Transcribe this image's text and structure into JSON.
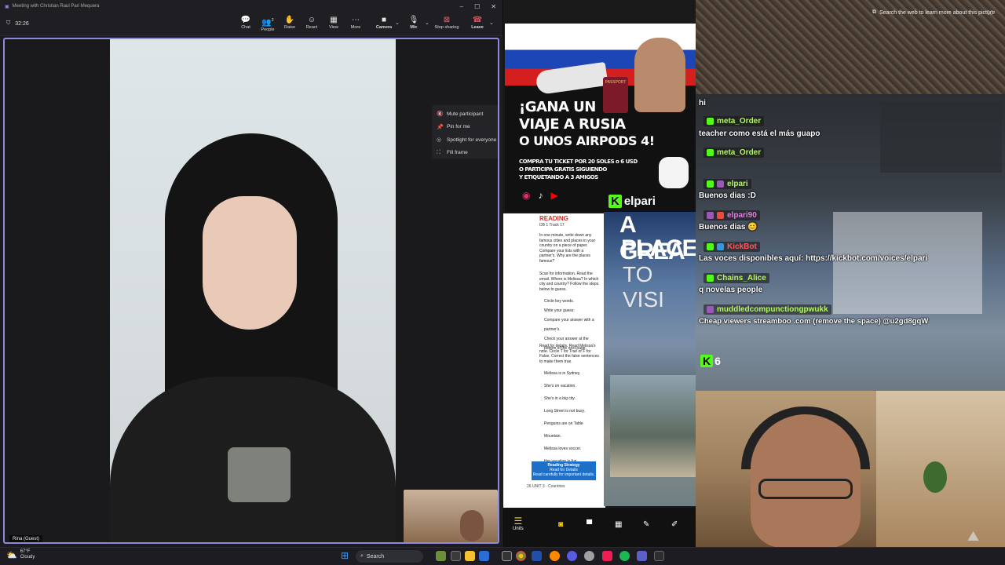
{
  "teams": {
    "window_title": "Meeting with Christian Raul Pari Mequera",
    "timer": "32:26",
    "toolbar": [
      {
        "label": "Chat",
        "icon": "chat-icon"
      },
      {
        "label": "People",
        "icon": "people-icon"
      },
      {
        "label": "Raise",
        "icon": "raise-hand-icon"
      },
      {
        "label": "React",
        "icon": "react-icon"
      },
      {
        "label": "View",
        "icon": "view-icon"
      },
      {
        "label": "More",
        "icon": "more-icon"
      },
      {
        "label": "Camera",
        "icon": "camera-icon"
      },
      {
        "label": "Mic",
        "icon": "mic-icon"
      },
      {
        "label": "Stop sharing",
        "icon": "stop-sharing-icon"
      },
      {
        "label": "Leave",
        "icon": "leave-icon"
      }
    ],
    "people_count": "2",
    "context_menu": [
      {
        "label": "Mute participant",
        "icon": "mute-icon"
      },
      {
        "label": "Pin for me",
        "icon": "pin-icon"
      },
      {
        "label": "Spotlight for everyone",
        "icon": "spotlight-icon"
      },
      {
        "label": "Fill frame",
        "icon": "fill-frame-icon"
      }
    ],
    "guest_name": "Rina (Guest)"
  },
  "right": {
    "search_web": "Search the web to learn more about this picture",
    "promo": {
      "line1": "¡GANA UN",
      "line2": "VIAJE A RUSIA",
      "line3": "O UNOS AIRPODS 4!",
      "line4": "COMPRA TU TICKET POR 20 SOLES o 6 USD",
      "line5": "O PARTICIPA GRATIS SIGUIENDO",
      "line6": "Y ETIQUETANDO A 3 AMIGOS",
      "brand": "elpari",
      "passport": "PASSPORT"
    },
    "book": {
      "section": "READING",
      "track": "DB 1 Track 17",
      "city_title_1": "A GREA",
      "city_title_2": "PLACE",
      "city_title_3": "TO VISI",
      "a_text": "In one minute, write down any famous cities and places in your country on a piece of paper. Compare your lists with a partner's. Why are the places famous?",
      "b_text": "Scan for information. Read the email. Where is Melissa? In which city and country? Follow the steps below to guess.",
      "steps": [
        "Circle key words.",
        "Write your guess:",
        "Compare your answer with a partner's.",
        "Check your answer at the bottom of the next page."
      ],
      "c_text": "Read for details. Read Melissa's note. Circle T for True or F for False. Correct the false sentences to make them true.",
      "tf": [
        "Melissa is in Sydney.",
        "She's on vacation.",
        "She's in a big city.",
        "Long Street is not busy.",
        "Penguins are on Table Mountain.",
        "Melissa loves soccer.",
        "Her vacation is fun."
      ],
      "strategy_title": "Reading Strategy",
      "strategy_sub": "Read for Details",
      "strategy_text": "Read carefully for important details.",
      "footer": "26  UNIT 3 · Countries",
      "units_label": "Units"
    },
    "chat": [
      {
        "user": "",
        "message": "hi",
        "color": "#ffffff"
      },
      {
        "user": "meta_Order",
        "message": "teacher como está el más guapo",
        "color": "#b6f26b"
      },
      {
        "user": "meta_Order",
        "message": "",
        "color": "#b6f26b"
      },
      {
        "user": "elpari",
        "message": "Buenos dias :D",
        "color": "#b6f26b"
      },
      {
        "user": "elpari90",
        "message": "Buenos dias",
        "color": "#e07be0"
      },
      {
        "user": "KickBot",
        "message": "Las voces disponibles aquí: https://kickbot.com/voices/elpari",
        "color": "#ff5a5a"
      },
      {
        "user": "Chains_Alice",
        "message": "q novelas people",
        "color": "#b6f26b"
      },
      {
        "user": "muddledcompunctiongpwukk",
        "message": "Cheap viewers streamboo .com (remove the space) @u2gd8gqW",
        "color": "#b6f26b"
      }
    ],
    "viewer_count": "6"
  },
  "taskbar": {
    "weather_temp": "67°F",
    "weather_desc": "Cloudy",
    "search_label": "Search"
  }
}
